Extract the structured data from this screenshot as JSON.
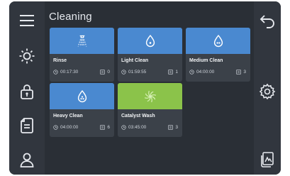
{
  "header": {
    "title": "Cleaning"
  },
  "left_nav": [
    {
      "icon": "menu-icon"
    },
    {
      "icon": "brightness-icon"
    },
    {
      "icon": "lock-icon"
    },
    {
      "icon": "document-icon"
    },
    {
      "icon": "user-icon"
    }
  ],
  "right_nav": [
    {
      "icon": "back-icon"
    },
    {
      "icon": "settings-icon"
    },
    {
      "icon": "export-icon"
    }
  ],
  "programs": [
    {
      "name": "Rinse",
      "time": "00:17:30",
      "count": "0",
      "icon": "rinse-spray-icon",
      "accent": "#4a89d0"
    },
    {
      "name": "Light Clean",
      "time": "01:59:55",
      "count": "1",
      "icon": "droplet-icon",
      "accent": "#4a89d0"
    },
    {
      "name": "Medium Clean",
      "time": "04:00:00",
      "count": "3",
      "icon": "droplet-icon",
      "accent": "#4a89d0"
    },
    {
      "name": "Heavy Clean",
      "time": "04:00:00",
      "count": "6",
      "icon": "droplet-icon",
      "accent": "#4a89d0"
    },
    {
      "name": "Catalyst Wash",
      "time": "03:45:00",
      "count": "3",
      "icon": "catalyst-swirl-icon",
      "accent": "#8bc34a"
    }
  ]
}
